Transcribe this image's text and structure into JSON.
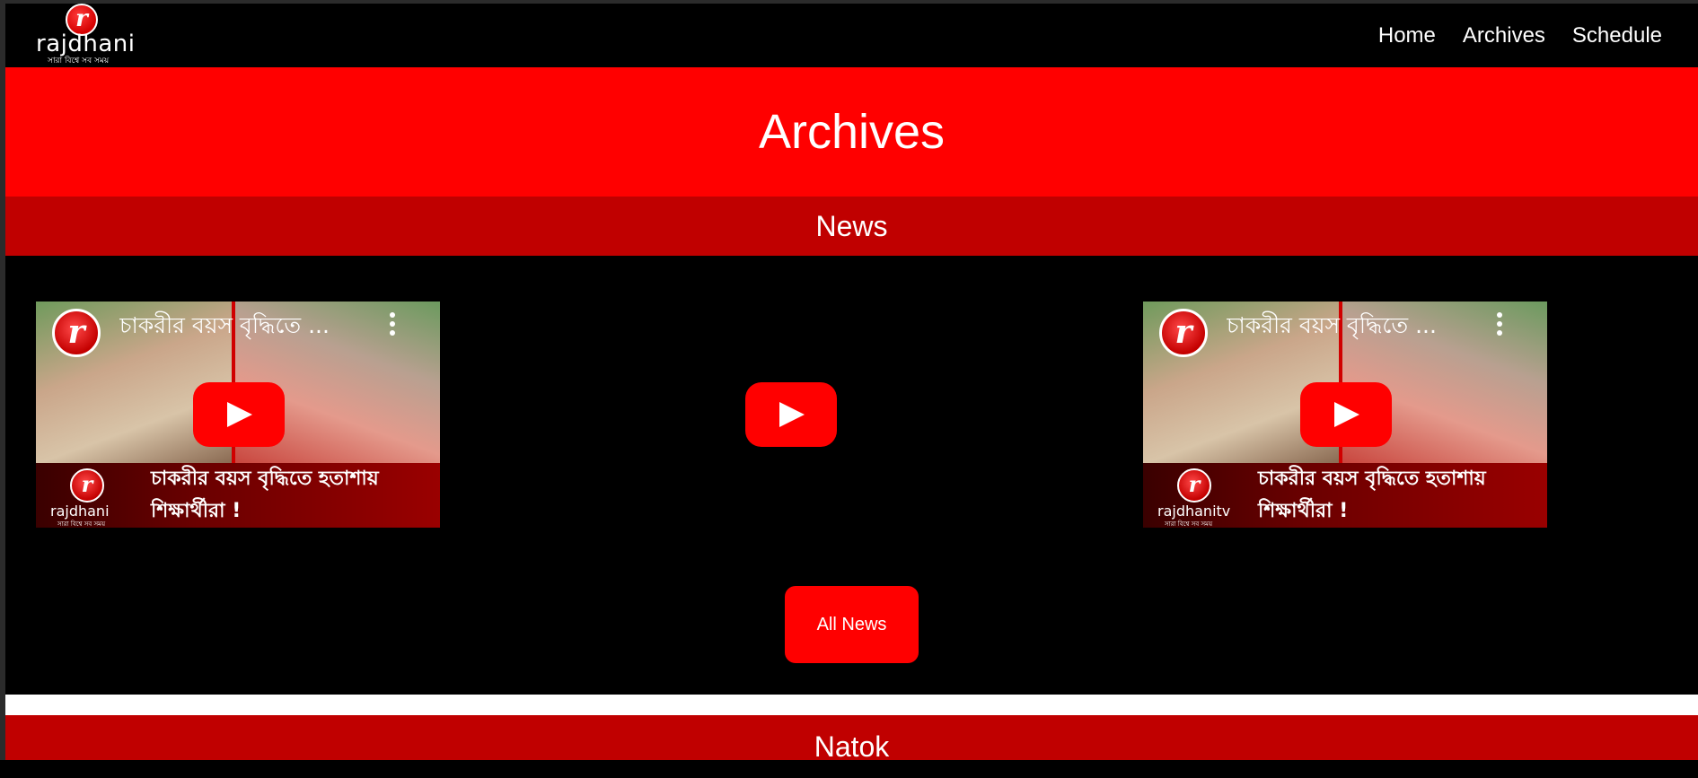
{
  "brand": {
    "logo_letter": "r",
    "name": "rajdhani",
    "tagline": "সারা বিশ্বে সব সময়"
  },
  "nav": {
    "items": [
      {
        "label": "Home"
      },
      {
        "label": "Archives"
      },
      {
        "label": "Schedule"
      }
    ]
  },
  "page": {
    "title": "Archives"
  },
  "sections": {
    "news": {
      "heading": "News",
      "videos": [
        {
          "title": "চাকরীর বয়স বৃদ্ধিতে ...",
          "caption_line1": "চাকরীর বয়স বৃদ্ধিতে হতাশায়",
          "caption_line2": "শিক্ষার্থীরা !",
          "thumb_logo_word": "rajdhani",
          "thumb_logo_tag": "সারা বিশ্বে সব সময়"
        },
        {
          "title": "চাকরীর বয়স বৃদ্ধিতে ...",
          "caption_line1": "চাকরীর বয়স বৃদ্ধিতে হতাশায়",
          "caption_line2": "শিক্ষার্থীরা !",
          "thumb_logo_word": "rajdhanitv",
          "thumb_logo_tag": "সারা বিশ্বে সব সময়"
        }
      ],
      "all_button_label": "All News"
    },
    "natok": {
      "heading": "Natok"
    }
  },
  "colors": {
    "primary_red": "#ff0000",
    "section_red": "#c00000",
    "background": "#000000"
  },
  "icons": {
    "play": "youtube-play-icon",
    "more": "more-vertical-icon"
  }
}
